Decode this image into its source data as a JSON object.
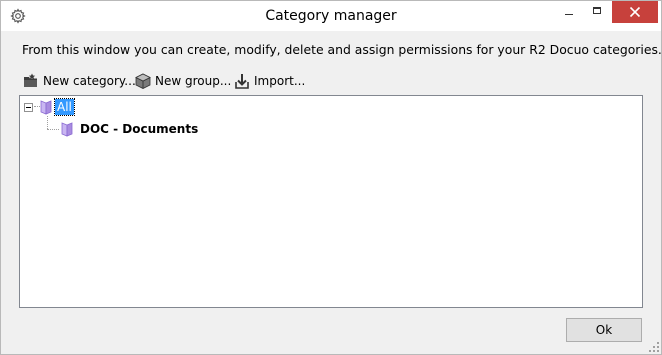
{
  "window": {
    "title": "Category manager",
    "accent_close": "#c7413c"
  },
  "description": "From this window you can create, modify, delete and assign permissions for your R2 Docuo categories.",
  "toolbar": {
    "new_category": "New category...",
    "new_group": "New group...",
    "import": "Import..."
  },
  "tree": {
    "root": {
      "label": "All",
      "expanded": true,
      "selected": true
    },
    "children": [
      {
        "label": "DOC - Documents"
      }
    ],
    "folder_color": "#a98ce0",
    "selection_color": "#3399ff"
  },
  "footer": {
    "ok_label": "Ok"
  }
}
